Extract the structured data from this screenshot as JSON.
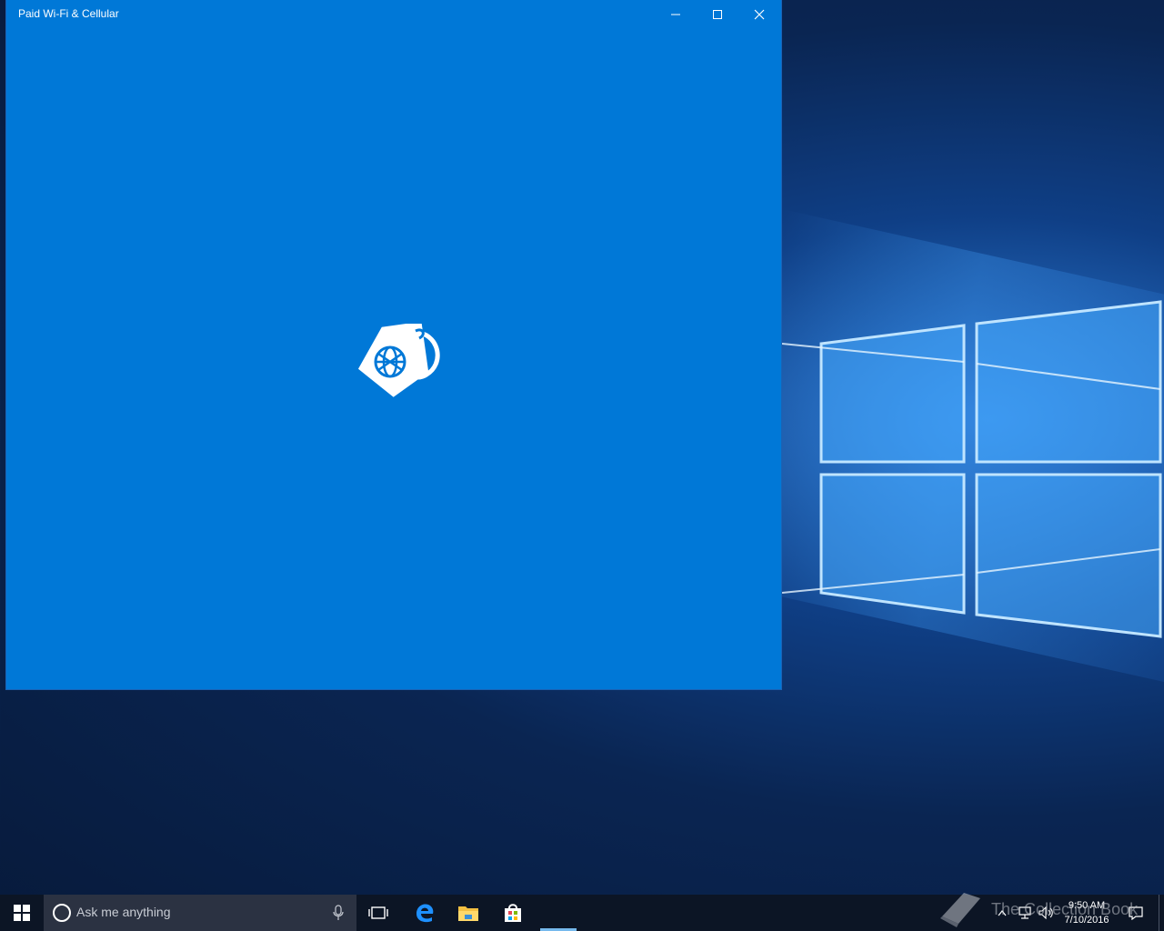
{
  "window": {
    "title": "Paid Wi-Fi & Cellular",
    "background": "#0078d7",
    "splash_icon": "sim-tag-globe-icon"
  },
  "taskbar": {
    "search_placeholder": "Ask me anything",
    "icons": [
      "windows-start-icon",
      "cortana-circle-icon",
      "microphone-icon",
      "task-view-icon",
      "edge-icon",
      "file-explorer-icon",
      "store-icon"
    ],
    "clock_time": "9:50 AM",
    "clock_date": "7/10/2016"
  },
  "watermark": {
    "text": "The Collection Book"
  },
  "colors": {
    "accent": "#0078d7",
    "taskbar": "#0c1525",
    "search_box": "#2b3242",
    "running_indicator": "#76b9ed"
  }
}
